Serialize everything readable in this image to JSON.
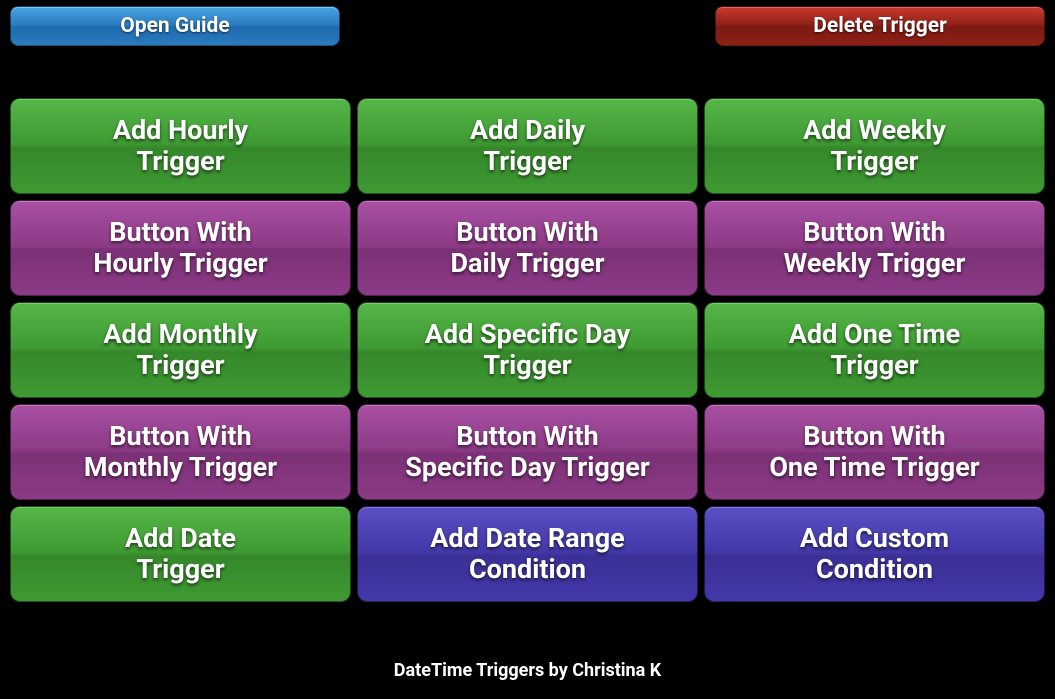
{
  "top": {
    "open_guide": "Open Guide",
    "delete_trigger": "Delete Trigger"
  },
  "grid": [
    {
      "label": "Add Hourly\nTrigger",
      "color": "green",
      "name": "add-hourly-trigger-button"
    },
    {
      "label": "Add Daily\nTrigger",
      "color": "green",
      "name": "add-daily-trigger-button"
    },
    {
      "label": "Add Weekly\nTrigger",
      "color": "green",
      "name": "add-weekly-trigger-button"
    },
    {
      "label": "Button With\nHourly Trigger",
      "color": "magenta",
      "name": "button-with-hourly-trigger-button"
    },
    {
      "label": "Button With\nDaily Trigger",
      "color": "magenta",
      "name": "button-with-daily-trigger-button"
    },
    {
      "label": "Button With\nWeekly Trigger",
      "color": "magenta",
      "name": "button-with-weekly-trigger-button"
    },
    {
      "label": "Add Monthly\nTrigger",
      "color": "green",
      "name": "add-monthly-trigger-button"
    },
    {
      "label": "Add Specific Day\nTrigger",
      "color": "green",
      "name": "add-specific-day-trigger-button"
    },
    {
      "label": "Add One Time\nTrigger",
      "color": "green",
      "name": "add-one-time-trigger-button"
    },
    {
      "label": "Button With\nMonthly Trigger",
      "color": "magenta",
      "name": "button-with-monthly-trigger-button"
    },
    {
      "label": "Button With\nSpecific Day Trigger",
      "color": "magenta",
      "name": "button-with-specific-day-trigger-button"
    },
    {
      "label": "Button With\nOne Time Trigger",
      "color": "magenta",
      "name": "button-with-one-time-trigger-button"
    },
    {
      "label": "Add Date\nTrigger",
      "color": "green",
      "name": "add-date-trigger-button"
    },
    {
      "label": "Add Date Range\nCondition",
      "color": "indigo",
      "name": "add-date-range-condition-button"
    },
    {
      "label": "Add Custom\nCondition",
      "color": "indigo",
      "name": "add-custom-condition-button"
    }
  ],
  "footer": "DateTime Triggers by Christina K"
}
